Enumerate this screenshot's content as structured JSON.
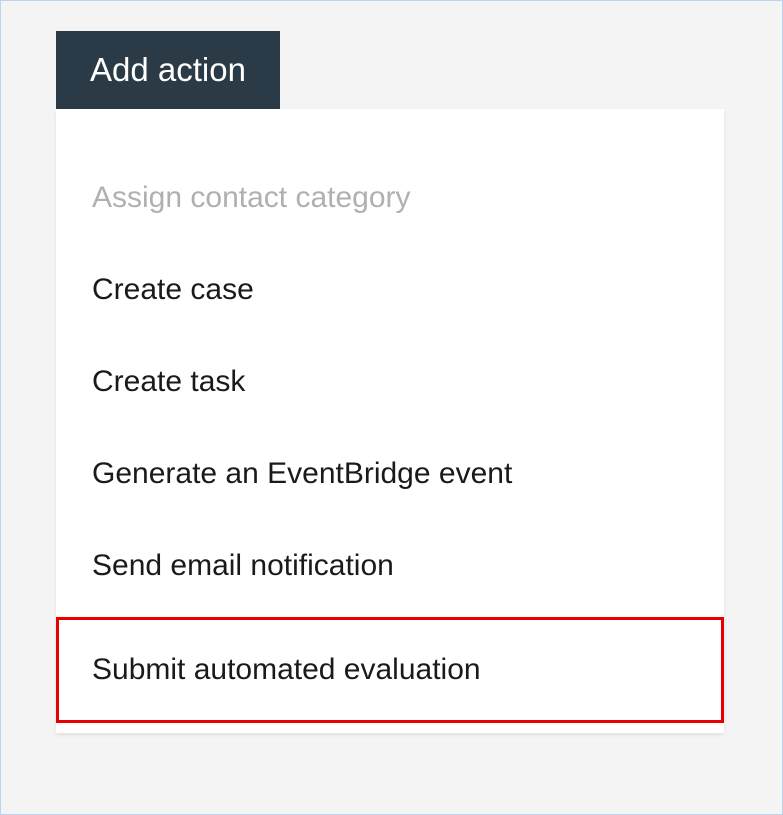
{
  "addActionButton": {
    "label": "Add action"
  },
  "menu": {
    "items": [
      {
        "label": "Assign contact category",
        "disabled": true,
        "highlighted": false
      },
      {
        "label": "Create case",
        "disabled": false,
        "highlighted": false
      },
      {
        "label": "Create task",
        "disabled": false,
        "highlighted": false
      },
      {
        "label": "Generate an EventBridge event",
        "disabled": false,
        "highlighted": false
      },
      {
        "label": "Send email notification",
        "disabled": false,
        "highlighted": false
      },
      {
        "label": "Submit automated evaluation",
        "disabled": false,
        "highlighted": true
      }
    ]
  }
}
